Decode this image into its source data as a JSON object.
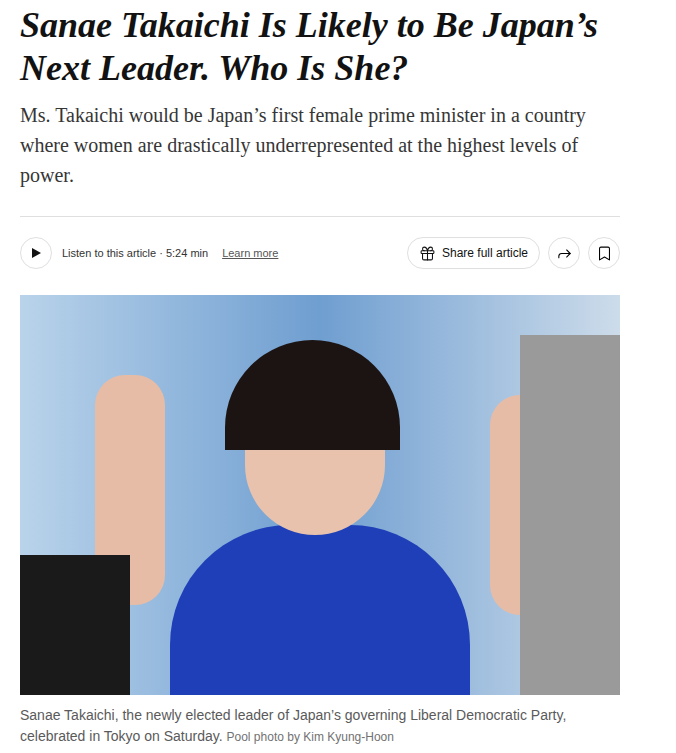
{
  "article": {
    "headline": "Sanae Takaichi Is Likely to Be Japan’s Next Leader. Who Is She?",
    "summary": "Ms. Takaichi would be Japan’s first female prime minister in a country where women are drastically underrepresented at the highest levels of power."
  },
  "toolbar": {
    "listen_label": "Listen to this article · 5:24 min",
    "learn_more": "Learn more",
    "share_label": "Share full article"
  },
  "photo": {
    "caption": "Sanae Takaichi, the newly elected leader of Japan’s governing Liberal Democratic Party, celebrated in Tokyo on Saturday.",
    "credit": "Pool photo by Kim Kyung-Hoon"
  }
}
